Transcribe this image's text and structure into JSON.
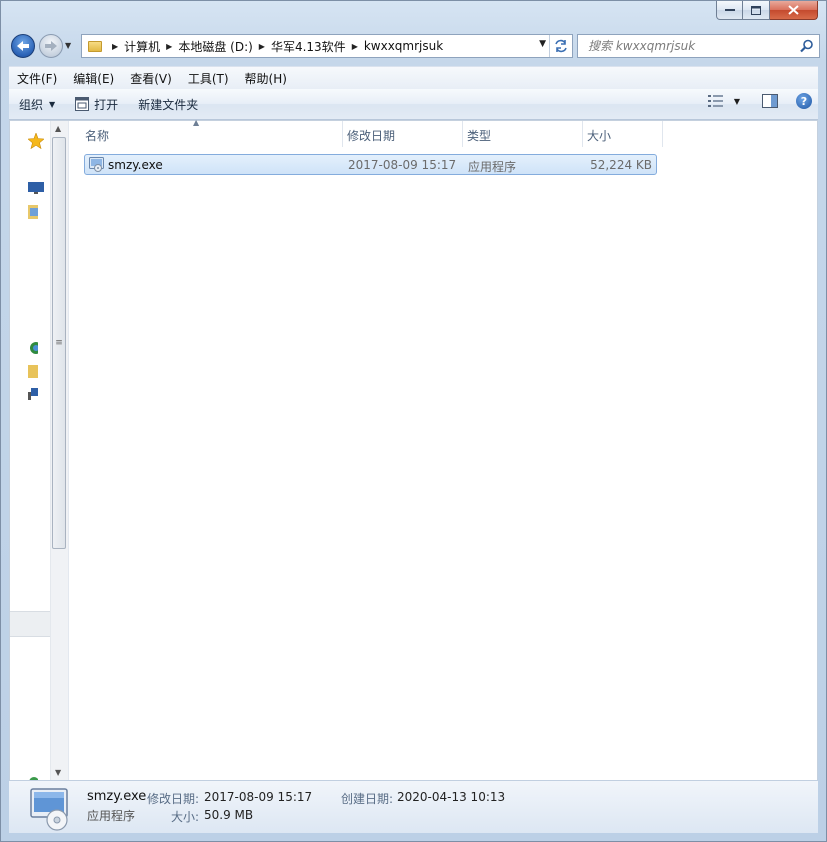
{
  "window": {
    "caption_buttons": {
      "minimize": "—",
      "maximize": "□",
      "close": "✕"
    }
  },
  "nav": {
    "back_icon": "arrow-left-icon",
    "forward_icon": "arrow-right-icon"
  },
  "address": {
    "crumbs": [
      "计算机",
      "本地磁盘 (D:)",
      "华军4.13软件",
      "kwxxqmrjsuk"
    ]
  },
  "search": {
    "placeholder": "搜索 kwxxqmrjsuk"
  },
  "menu": {
    "items": [
      "文件(F)",
      "编辑(E)",
      "查看(V)",
      "工具(T)",
      "帮助(H)"
    ]
  },
  "toolbar": {
    "organize": "组织",
    "open": "打开",
    "new_folder": "新建文件夹"
  },
  "columns": {
    "name": "名称",
    "date": "修改日期",
    "type": "类型",
    "size": "大小"
  },
  "files": [
    {
      "name": "smzy.exe",
      "date": "2017-08-09 15:17",
      "type": "应用程序",
      "size": "52,224 KB"
    }
  ],
  "details": {
    "name": "smzy.exe",
    "type": "应用程序",
    "modified_label": "修改日期:",
    "modified_value": "2017-08-09 15:17",
    "created_label": "创建日期:",
    "created_value": "2020-04-13 10:13",
    "size_label": "大小:",
    "size_value": "50.9 MB"
  },
  "colors": {
    "accent": "#2a62b6",
    "selection": "#cfe3f8",
    "selection_border": "#84acdd"
  }
}
